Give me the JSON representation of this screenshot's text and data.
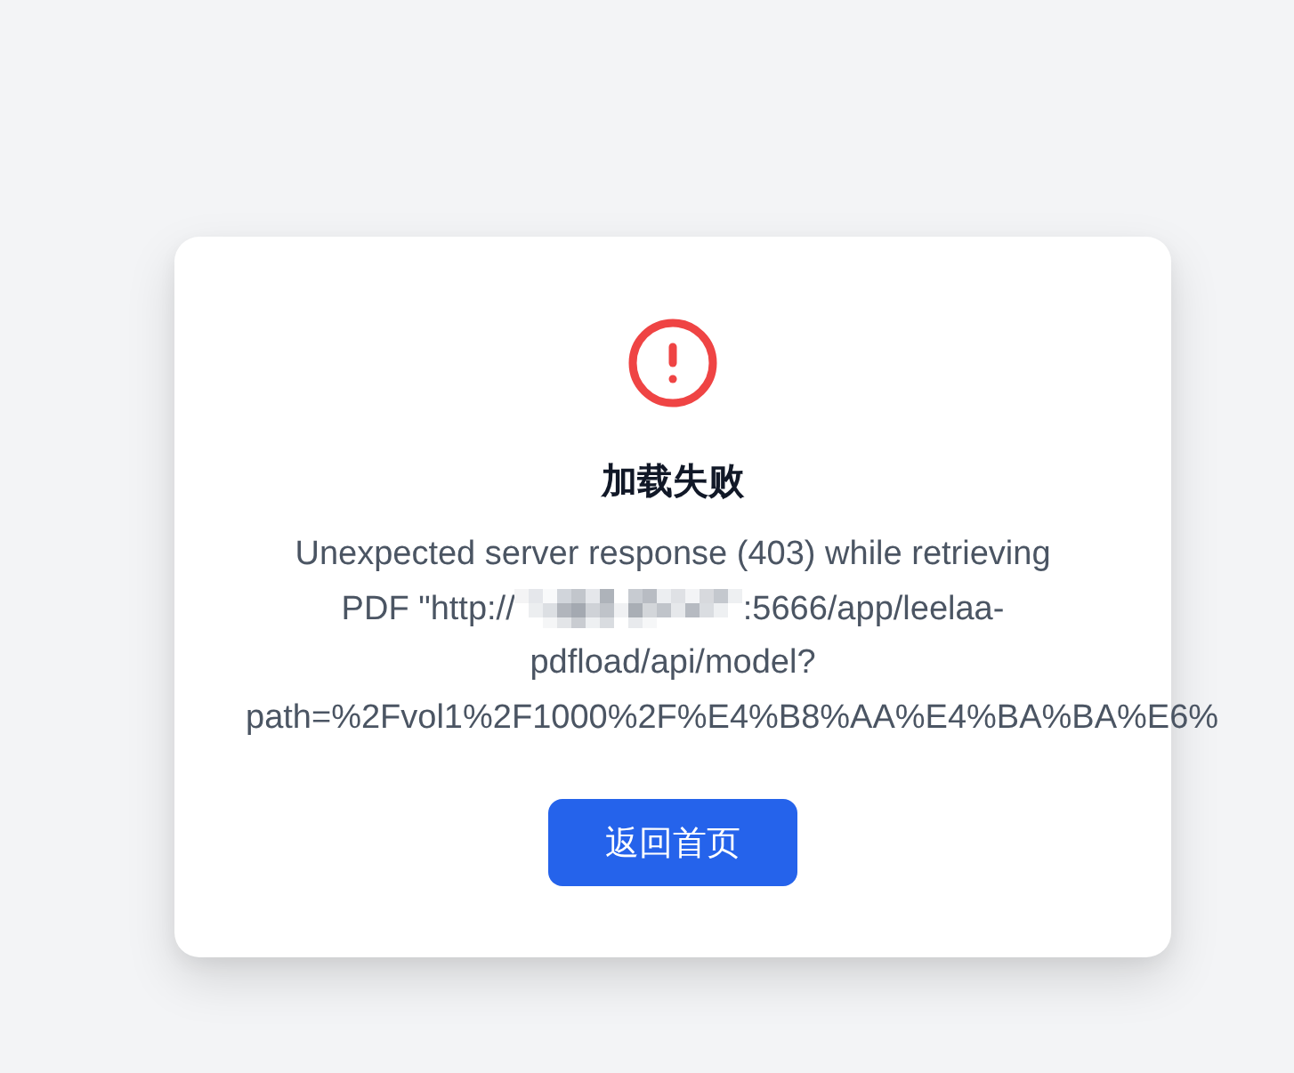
{
  "card": {
    "title": "加载失败",
    "message": {
      "lines": [
        [
          {
            "kind": "text",
            "text": "Unexpected server response (403) while retrieving"
          }
        ],
        [
          {
            "kind": "text",
            "text": "PDF \"http://"
          },
          {
            "kind": "redacted"
          },
          {
            "kind": "text",
            "text": ":5666/app/leelaa-"
          }
        ],
        [
          {
            "kind": "text",
            "text": "pdfload/api/model?"
          }
        ],
        [
          {
            "kind": "text",
            "text": "path=%2Fvol1%2F1000%2F%E4%B8%AA%E4%BA%BA%E6%"
          }
        ]
      ]
    },
    "button": {
      "label": "返回首页"
    }
  }
}
